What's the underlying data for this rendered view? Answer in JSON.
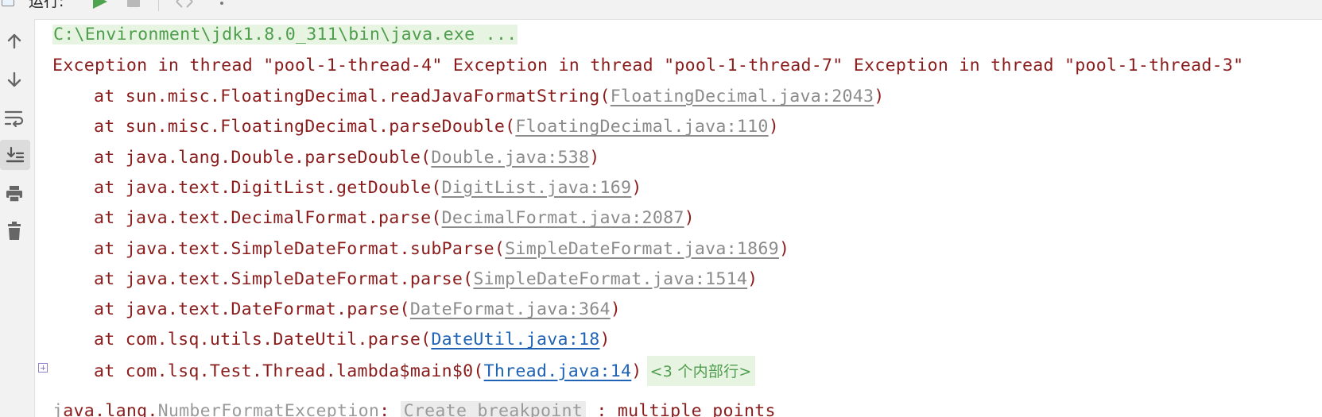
{
  "toolbar": {
    "run_tab_label": "运行:"
  },
  "console": {
    "command": "C:\\Environment\\jdk1.8.0_311\\bin\\java.exe ...",
    "exception_header": "Exception in thread \"pool-1-thread-4\" Exception in thread \"pool-1-thread-7\" Exception in thread \"pool-1-thread-3\"",
    "frames": [
      {
        "prefix": "at sun.misc.FloatingDecimal.readJavaFormatString(",
        "link": "FloatingDecimal.java:2043",
        "suffix": ")"
      },
      {
        "prefix": "at sun.misc.FloatingDecimal.parseDouble(",
        "link": "FloatingDecimal.java:110",
        "suffix": ")"
      },
      {
        "prefix": "at java.lang.Double.parseDouble(",
        "link": "Double.java:538",
        "suffix": ")"
      },
      {
        "prefix": "at java.text.DigitList.getDouble(",
        "link": "DigitList.java:169",
        "suffix": ")"
      },
      {
        "prefix": "at java.text.DecimalFormat.parse(",
        "link": "DecimalFormat.java:2087",
        "suffix": ")"
      },
      {
        "prefix": "at java.text.SimpleDateFormat.subParse(",
        "link": "SimpleDateFormat.java:1869",
        "suffix": ")"
      },
      {
        "prefix": "at java.text.SimpleDateFormat.parse(",
        "link": "SimpleDateFormat.java:1514",
        "suffix": ")"
      },
      {
        "prefix": "at java.text.DateFormat.parse(",
        "link": "DateFormat.java:364",
        "suffix": ")"
      },
      {
        "prefix": "at com.lsq.utils.DateUtil.parse(",
        "link": "DateUtil.java:18",
        "suffix": ")"
      },
      {
        "prefix": "at com.lsq.Test.Thread.lambda$main$0(",
        "link": "Thread.java:14",
        "suffix": ")"
      }
    ],
    "folded_label": "<3 个内部行>"
  },
  "colors": {
    "error_text": "#8b1c1c",
    "command_text": "#4e9e4e",
    "library_link": "#8b8b8b",
    "user_link": "#1f63b5"
  },
  "icons": {
    "sidebar": [
      "arrow-up-icon",
      "arrow-down-icon",
      "soft-wrap-icon",
      "scroll-to-end-icon",
      "print-icon",
      "trash-icon"
    ],
    "toolbar": [
      "run-icon",
      "stop-icon",
      "restore-layout-icon",
      "more-icon"
    ]
  }
}
